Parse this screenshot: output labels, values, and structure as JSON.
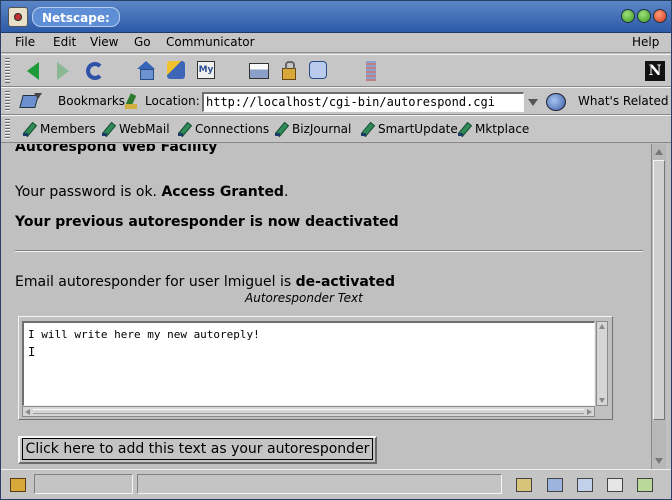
{
  "window": {
    "title": "Netscape:"
  },
  "menu": [
    "File",
    "Edit",
    "View",
    "Go",
    "Communicator",
    "Help"
  ],
  "toolbar": {
    "icons": [
      "back-icon",
      "forward-icon",
      "reload-icon",
      "home-icon",
      "search-icon",
      "guide-icon",
      "print-icon",
      "security-icon",
      "shop-icon",
      "stop-icon",
      "netscape-logo"
    ]
  },
  "location": {
    "bookmarks_label": "Bookmarks",
    "location_label": "Location:",
    "url": "http://localhost/cgi-bin/autorespond.cgi",
    "whats_related": "What's Related"
  },
  "links": [
    "Members",
    "WebMail",
    "Connections",
    "BizJournal",
    "SmartUpdate",
    "Mktplace"
  ],
  "page": {
    "heading": "Autorespond Web Facility",
    "password_prefix": "Your password is ok. ",
    "password_status": "Access Granted",
    "password_suffix": ".",
    "deactivated_notice": "Your previous autoresponder is now deactivated",
    "status_prefix": "Email autoresponder for user lmiguel is ",
    "status_value": "de-activated",
    "caption": "Autoresponder Text",
    "textarea_value": "I will write here my new autoreply!",
    "submit_label": "Click here to add this text as your autoresponder"
  }
}
